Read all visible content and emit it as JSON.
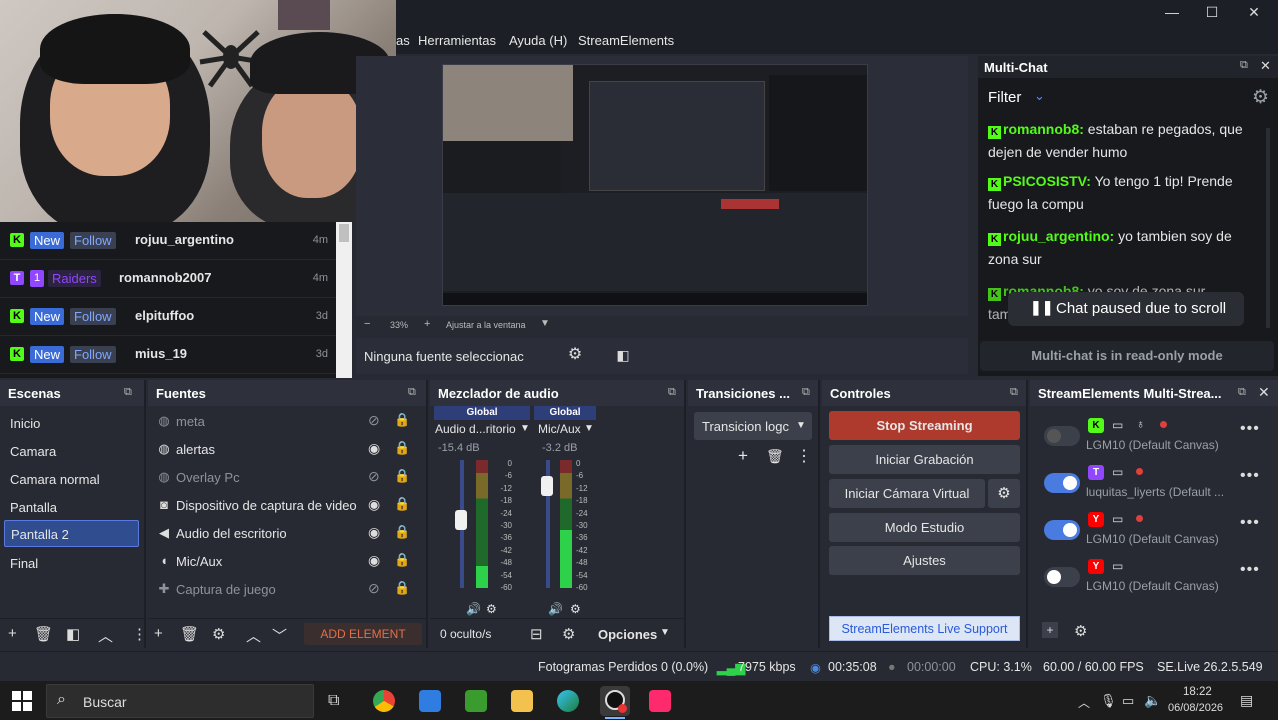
{
  "window": {
    "minimize": "—",
    "maximize": "☐",
    "close": "✕"
  },
  "menu": [
    "as",
    "Herramientas",
    "Ayuda (H)",
    "StreamElements"
  ],
  "alerts": [
    {
      "platform": "K",
      "badge": "New",
      "action": "Follow",
      "user": "rojuu_argentino",
      "time": "4m",
      "color": "#53fc18"
    },
    {
      "platform": "T",
      "count": "1",
      "action": "Raiders",
      "user": "romannob2007",
      "time": "4m",
      "color": "#9146ff"
    },
    {
      "platform": "K",
      "badge": "New",
      "action": "Follow",
      "user": "elpituffoo",
      "time": "3d",
      "color": "#53fc18"
    },
    {
      "platform": "K",
      "badge": "New",
      "action": "Follow",
      "user": "mius_19",
      "time": "3d",
      "color": "#53fc18"
    }
  ],
  "preview": {
    "zoom": "33%",
    "fit": "Ajustar a la ventana",
    "no_source": "Ninguna fuente seleccionac"
  },
  "multichat": {
    "title": "Multi-Chat",
    "filter": "Filter",
    "messages": [
      {
        "user": "romannob8:",
        "text": "estaban re pegados, que dejen de vender humo"
      },
      {
        "user": "PSICOSISTV:",
        "text": "Yo tengo 1 tip! Prende fuego la compu"
      },
      {
        "user": "rojuu_argentino:",
        "text": "yo tambien soy de zona sur"
      },
      {
        "user": "romannob8:",
        "text": "yo soy de zona sur tambien"
      }
    ],
    "paused": "Chat paused due to scroll",
    "readonly": "Multi-chat is in read-only mode"
  },
  "scenes": {
    "title": "Escenas",
    "items": [
      "Inicio",
      "Camara",
      "Camara normal",
      "Pantalla",
      "Pantalla 2",
      "Final"
    ],
    "selected": 4
  },
  "sources": {
    "title": "Fuentes",
    "items": [
      {
        "name": "meta",
        "visible": false
      },
      {
        "name": "alertas",
        "visible": true
      },
      {
        "name": "Overlay Pc",
        "visible": false
      },
      {
        "name": "Dispositivo de captura de video",
        "visible": true
      },
      {
        "name": "Audio del escritorio",
        "visible": true
      },
      {
        "name": "Mic/Aux",
        "visible": true
      },
      {
        "name": "Captura de juego",
        "visible": false
      }
    ],
    "add_element": "ADD ELEMENT"
  },
  "mixer": {
    "title": "Mezclador de audio",
    "channels": [
      {
        "tag": "Global",
        "name": "Audio d...ritorio",
        "db": "-15.4 dB",
        "level": 0.55
      },
      {
        "tag": "Global",
        "name": "Mic/Aux",
        "db": "-3.2 dB",
        "level": 0.9
      }
    ],
    "scale": [
      "0",
      "-6",
      "-12",
      "-18",
      "-24",
      "-30",
      "-36",
      "-42",
      "-48",
      "-54",
      "-60"
    ],
    "hidden": "0 oculto/s",
    "options": "Opciones"
  },
  "transitions": {
    "title": "Transiciones ...",
    "selected": "Transicion logc"
  },
  "controls": {
    "title": "Controles",
    "stop": "Stop Streaming",
    "record": "Iniciar Grabación",
    "vcam": "Iniciar Cámara Virtual",
    "studio": "Modo Estudio",
    "settings": "Ajustes",
    "support": "StreamElements Live Support"
  },
  "se_multistream": {
    "title": "StreamElements Multi-Strea...",
    "rows": [
      {
        "on": false,
        "platform": "K",
        "name": "LGM10 (Default Canvas)",
        "color": "#53fc18"
      },
      {
        "on": true,
        "platform": "T",
        "name": "luquitas_liyerts (Default ...",
        "color": "#9146ff"
      },
      {
        "on": true,
        "platform": "Y",
        "name": "LGM10 (Default Canvas)",
        "color": "#ff0000"
      },
      {
        "on": false,
        "platform": "Y",
        "name": "LGM10 (Default Canvas)",
        "color": "#ff0000"
      }
    ]
  },
  "status": {
    "frames": "Fotogramas Perdidos 0 (0.0%)",
    "kbps": "7975 kbps",
    "stream_time": "00:35:08",
    "rec_time": "00:00:00",
    "cpu": "CPU: 3.1%",
    "fps": "60.00 / 60.00 FPS",
    "version": "SE.Live 26.2.5.549"
  },
  "taskbar": {
    "search": "Buscar",
    "time": "18:22",
    "date": "06/08/2026"
  }
}
